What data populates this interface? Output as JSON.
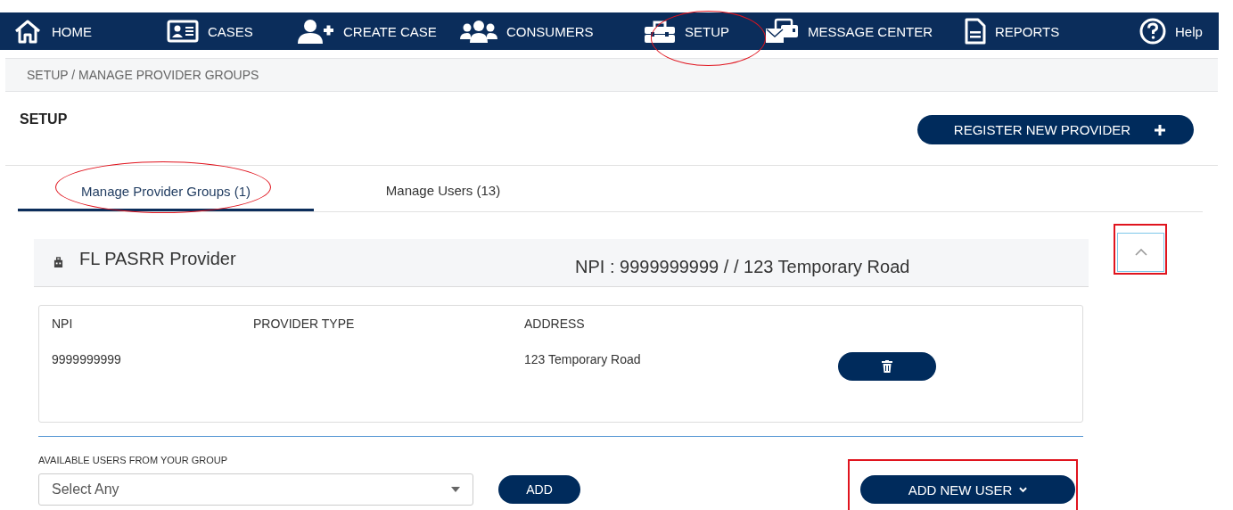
{
  "nav": [
    {
      "label": "HOME"
    },
    {
      "label": "CASES"
    },
    {
      "label": "CREATE CASE"
    },
    {
      "label": "CONSUMERS"
    },
    {
      "label": "SETUP"
    },
    {
      "label": "MESSAGE CENTER"
    },
    {
      "label": "REPORTS"
    },
    {
      "label": "Help"
    }
  ],
  "breadcrumb": "SETUP / MANAGE PROVIDER GROUPS",
  "page_title": "SETUP",
  "register_button": "REGISTER NEW PROVIDER",
  "tabs": [
    {
      "label": "Manage Provider Groups (1)",
      "selected": true
    },
    {
      "label": "Manage Users (13)",
      "selected": false
    }
  ],
  "provider": {
    "name": "FL PASRR Provider",
    "summary": "NPI : 9999999999 / / 123 Temporary Road",
    "expanded": true,
    "table": {
      "columns": [
        "NPI",
        "PROVIDER TYPE",
        "ADDRESS"
      ],
      "rows": [
        [
          "9999999999",
          "",
          "123 Temporary Road"
        ]
      ]
    }
  },
  "users_label": "AVAILABLE USERS FROM YOUR GROUP",
  "select": {
    "placeholder": "Select Any"
  },
  "add_button": "ADD",
  "add_new_user_button": "ADD NEW USER"
}
